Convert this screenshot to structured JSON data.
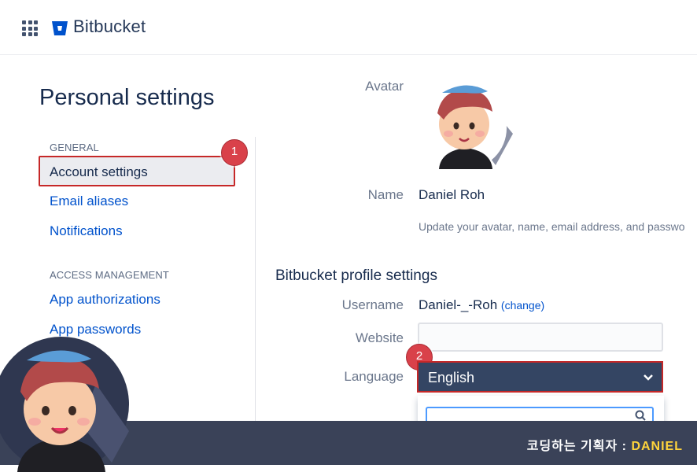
{
  "app": {
    "name": "Bitbucket"
  },
  "page": {
    "title": "Personal settings"
  },
  "sidebar": {
    "sections": [
      {
        "label": "GENERAL",
        "items": [
          "Account settings",
          "Email aliases",
          "Notifications"
        ]
      },
      {
        "label": "ACCESS MANAGEMENT",
        "items": [
          "App authorizations",
          "App passwords"
        ]
      }
    ],
    "active": "Account settings"
  },
  "account": {
    "avatar_label": "Avatar",
    "name_label": "Name",
    "name_value": "Daniel Roh",
    "help": "Update your avatar, name, email address, and passwo"
  },
  "profile": {
    "title": "Bitbucket profile settings",
    "username_label": "Username",
    "username_value": "Daniel-_-Roh",
    "change_link": "(change)",
    "website_label": "Website",
    "website_value": "",
    "language_label": "Language",
    "language_value": "English"
  },
  "badges": {
    "first": "1",
    "second": "2"
  },
  "footer": {
    "prefix": "코딩하는 기획자 : ",
    "accent": "DANIEL"
  },
  "colors": {
    "brand": "#0052cc",
    "highlight": "#c62828",
    "select_bg": "#344563",
    "footer_bg": "#3a4258",
    "accent": "#ffd43b"
  },
  "icons": [
    "app-grid-icon",
    "bitbucket-logo-icon",
    "chevron-down-icon",
    "search-icon"
  ]
}
